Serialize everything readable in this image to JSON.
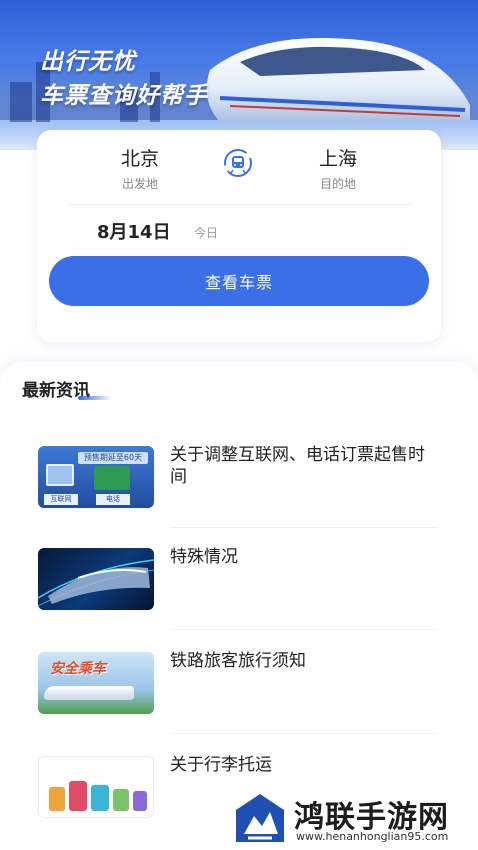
{
  "hero": {
    "line1": "出行无忧",
    "line2": "车票查询好帮手"
  },
  "search": {
    "from_city": "北京",
    "from_label": "出发地",
    "to_city": "上海",
    "to_label": "目的地",
    "date": "8月14日",
    "date_tag": "今日",
    "button_label": "查看车票"
  },
  "news": {
    "heading": "最新资讯",
    "items": [
      {
        "title": "关于调整互联网、电话订票起售时间",
        "thumb": "online-phone-ticket-image",
        "thumb_text_top": "预售期延至60天",
        "thumb_text_a": "互联网",
        "thumb_text_b": "电话"
      },
      {
        "title": "特殊情况",
        "thumb": "night-train-image"
      },
      {
        "title": "铁路旅客旅行须知",
        "thumb": "safe-ride-train-image",
        "thumb_text": "安全乘车"
      },
      {
        "title": "关于行李托运",
        "thumb": "luggage-image"
      }
    ]
  },
  "watermark": {
    "name": "鸿联手游网",
    "url": "www.henanhonglian95.com"
  },
  "colors": {
    "accent": "#3b6fe8",
    "hero_top": "#2f5fd8"
  }
}
